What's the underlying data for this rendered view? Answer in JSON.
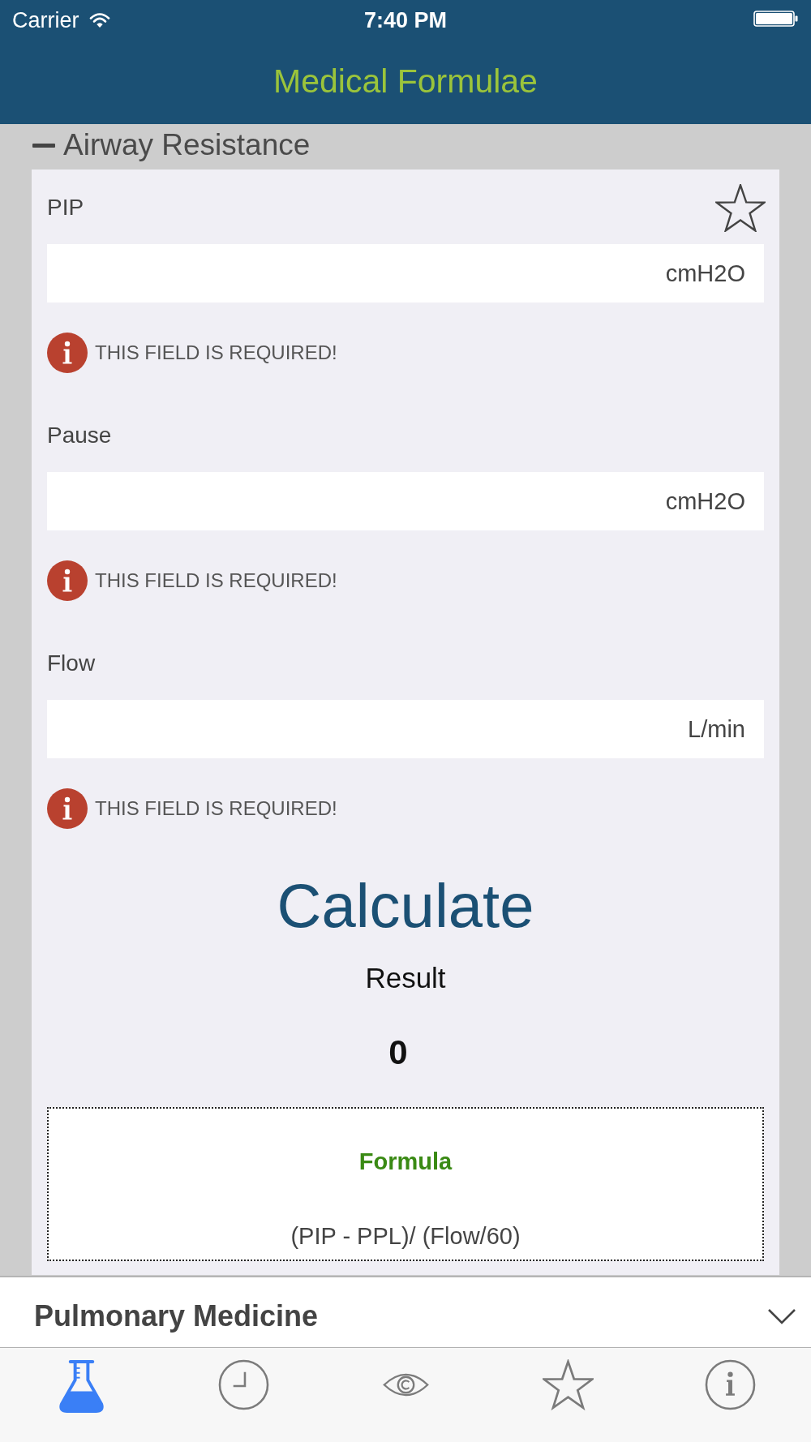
{
  "status_bar": {
    "carrier": "Carrier",
    "time": "7:40 PM"
  },
  "nav_bar": {
    "title": "Medical Formulae"
  },
  "section": {
    "title": "Airway Resistance",
    "expanded": true,
    "favorited": false,
    "fields": [
      {
        "label": "PIP",
        "unit": "cmH2O",
        "error": "THIS FIELD IS REQUIRED!"
      },
      {
        "label": "Pause",
        "unit": "cmH2O",
        "error": "THIS FIELD IS REQUIRED!"
      },
      {
        "label": "Flow",
        "unit": "L/min",
        "error": "THIS FIELD IS REQUIRED!"
      }
    ],
    "calculate_button": "Calculate",
    "result": {
      "label": "Result",
      "value": "0"
    },
    "formula": {
      "title": "Formula",
      "expression": "(PIP - PPL)/ (Flow/60)"
    }
  },
  "category_bar": {
    "label": "Pulmonary Medicine"
  },
  "tab_bar": {
    "items": [
      {
        "selected": true
      },
      {
        "selected": false
      },
      {
        "selected": false
      },
      {
        "selected": false
      },
      {
        "selected": false
      }
    ]
  }
}
